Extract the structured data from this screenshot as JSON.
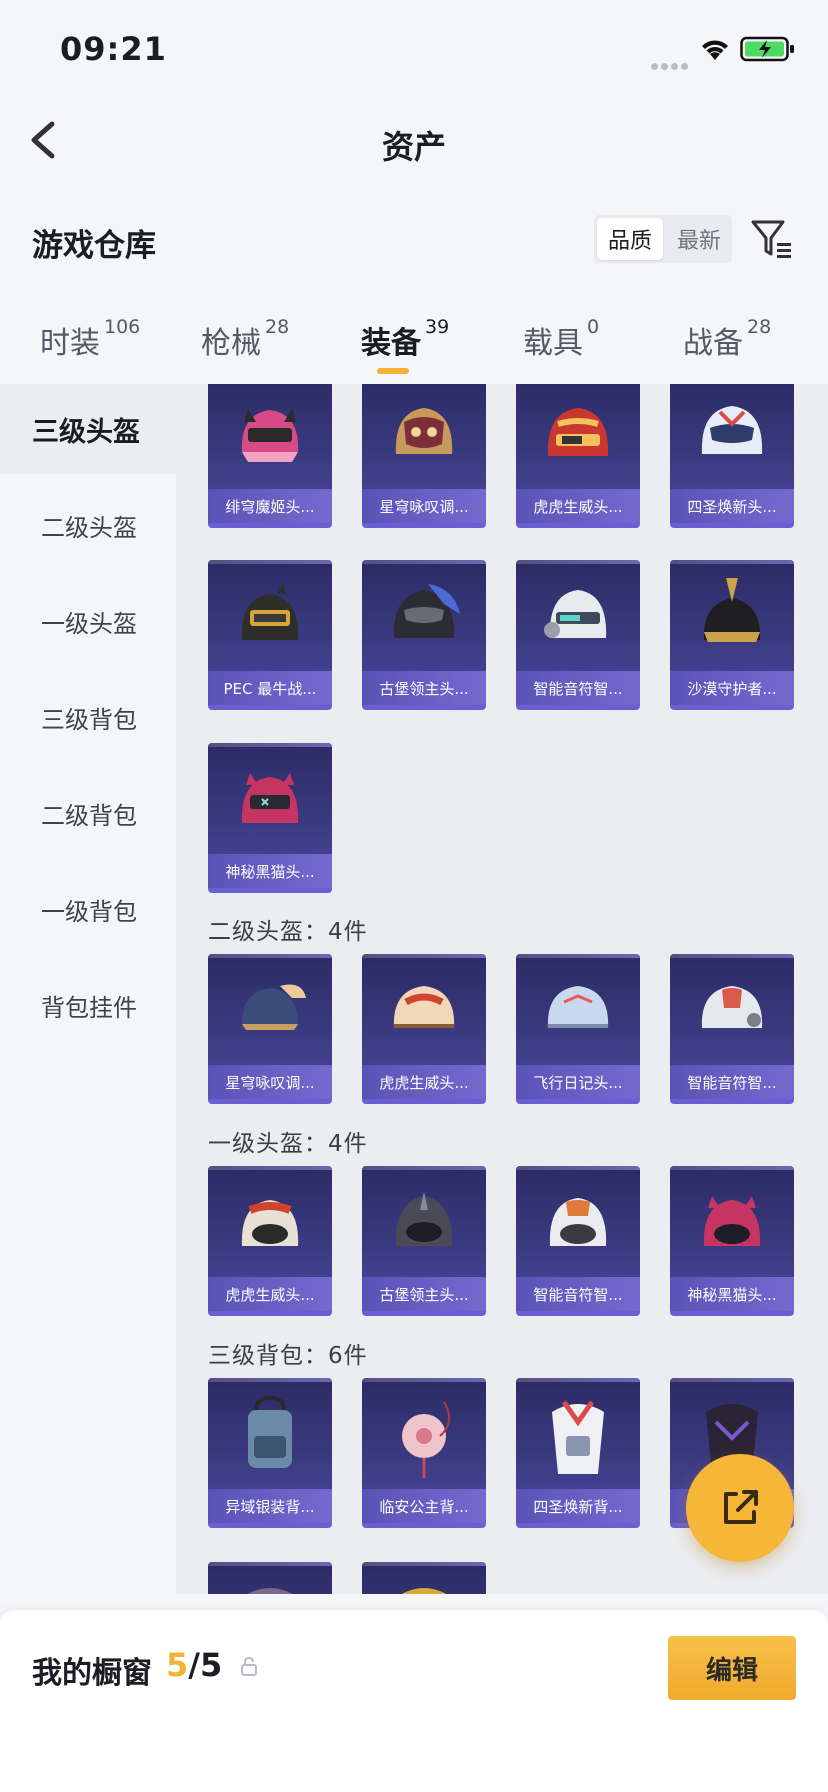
{
  "status_bar": {
    "time": "09:21"
  },
  "nav": {
    "title": "资产"
  },
  "warehouse": {
    "title": "游戏仓库",
    "sort_options": [
      "品质",
      "最新"
    ],
    "active_sort": "品质"
  },
  "category_tabs": [
    {
      "label": "时装",
      "count": "106"
    },
    {
      "label": "枪械",
      "count": "28"
    },
    {
      "label": "装备",
      "count": "39",
      "active": true
    },
    {
      "label": "载具",
      "count": "0"
    },
    {
      "label": "战备",
      "count": "28"
    }
  ],
  "sidebar": {
    "items": [
      "三级头盔",
      "二级头盔",
      "一级头盔",
      "三级背包",
      "二级背包",
      "一级背包",
      "背包挂件"
    ],
    "active_index": 0
  },
  "sections": {
    "lvl3_helmet": {
      "items": [
        "绯穹魔姬头...",
        "星穹咏叹调...",
        "虎虎生威头...",
        "四圣焕新头...",
        "PEC 最牛战...",
        "古堡领主头...",
        "智能音符智...",
        "沙漠守护者...",
        "神秘黑猫头..."
      ]
    },
    "lvl2_helmet": {
      "title": "二级头盔：4件",
      "items": [
        "星穹咏叹调...",
        "虎虎生威头...",
        "飞行日记头...",
        "智能音符智..."
      ]
    },
    "lvl1_helmet": {
      "title": "一级头盔：4件",
      "items": [
        "虎虎生威头...",
        "古堡领主头...",
        "智能音符智...",
        "神秘黑猫头..."
      ]
    },
    "lvl3_backpack": {
      "title": "三级背包：6件",
      "items": [
        "异域银装背...",
        "临安公主背...",
        "四圣焕新背...",
        ""
      ]
    }
  },
  "showcase": {
    "label": "我的橱窗",
    "current": "5",
    "separator": "/",
    "total": "5",
    "edit_label": "编辑"
  },
  "colors": {
    "accent": "#f2b233",
    "card_purple": "#3b3a80",
    "card_label": "#6a5fd2"
  }
}
